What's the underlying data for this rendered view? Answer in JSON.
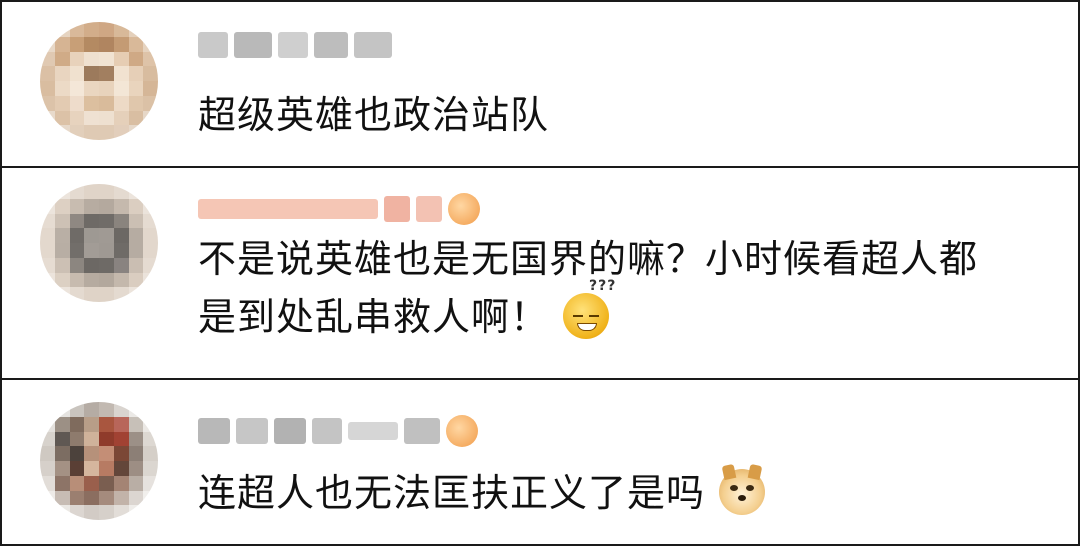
{
  "comments": [
    {
      "text": "超级英雄也政治站队",
      "avatar_icon": "blurred-avatar-icon"
    },
    {
      "text_line1": "不是说英雄也是无国界的嘛？小时候看超人都",
      "text_line2": "是到处乱串救人啊！",
      "avatar_icon": "blurred-avatar-icon",
      "emoji": "sweat-confused-emoji-icon",
      "emoji_marks": "???"
    },
    {
      "text": "连超人也无法匡扶正义了是吗",
      "avatar_icon": "blurred-avatar-icon",
      "emoji": "doge-emoji-icon"
    }
  ],
  "colors": {
    "border": "#1a1a1a",
    "text": "#111111",
    "badge": "#f19b48"
  }
}
